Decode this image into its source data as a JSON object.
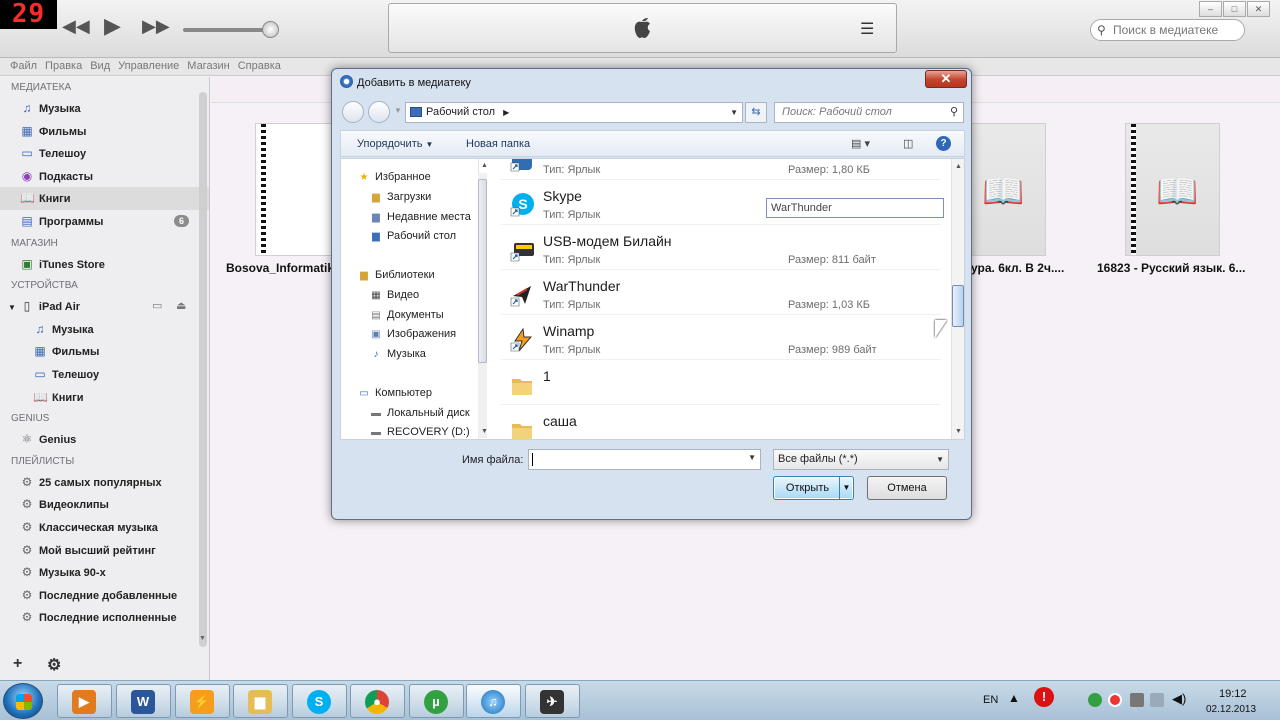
{
  "overlay_badge": "29",
  "itunes": {
    "search_placeholder": "Поиск в медиатеке",
    "menu": [
      "Файл",
      "Правка",
      "Вид",
      "Управление",
      "Магазин",
      "Справка"
    ]
  },
  "sidebar": {
    "sections": {
      "library": "МЕДИАТЕКА",
      "store": "МАГАЗИН",
      "devices": "УСТРОЙСТВА",
      "genius": "GENIUS",
      "playlists": "ПЛЕЙЛИСТЫ"
    },
    "library_items": [
      {
        "label": "Музыка",
        "icon": "♫"
      },
      {
        "label": "Фильмы",
        "icon": "▦"
      },
      {
        "label": "Телешоу",
        "icon": "▭"
      },
      {
        "label": "Подкасты",
        "icon": "◉"
      },
      {
        "label": "Книги",
        "icon": "📖"
      },
      {
        "label": "Программы",
        "icon": "▤",
        "count": "6"
      }
    ],
    "store_items": [
      {
        "label": "iTunes Store",
        "icon": "▣"
      }
    ],
    "device": {
      "label": "iPad Air"
    },
    "device_items": [
      {
        "label": "Музыка",
        "icon": "♫"
      },
      {
        "label": "Фильмы",
        "icon": "▦"
      },
      {
        "label": "Телешоу",
        "icon": "▭"
      },
      {
        "label": "Книги",
        "icon": "📖"
      }
    ],
    "genius_items": [
      {
        "label": "Genius",
        "icon": "⚛"
      }
    ],
    "playlists": [
      "25 самых популярных",
      "Видеоклипы",
      "Классическая музыка",
      "Мой высший рейтинг",
      "Музыка 90-х",
      "Последние добавленные",
      "Последние исполненные"
    ]
  },
  "books": [
    {
      "title": "Bosova_Informatik..."
    },
    {
      "title": "ура. 6кл. В 2ч...."
    },
    {
      "title": "16823 - Русский язык. 6..."
    }
  ],
  "dialog": {
    "title": "Добавить в медиатеку",
    "address": "Рабочий стол",
    "search_placeholder": "Поиск: Рабочий стол",
    "toolbar": {
      "organize": "Упорядочить",
      "new_folder": "Новая папка"
    },
    "nav": {
      "favorites": "Избранное",
      "favorites_items": [
        "Загрузки",
        "Недавние места",
        "Рабочий стол"
      ],
      "libraries": "Библиотеки",
      "libraries_items": [
        "Видео",
        "Документы",
        "Изображения",
        "Музыка"
      ],
      "computer": "Компьютер",
      "computer_items": [
        "Локальный диск",
        "RECOVERY (D:)"
      ]
    },
    "files": [
      {
        "name": "",
        "type": "Тип: Ярлык",
        "size": "Размер: 1,80 КБ"
      },
      {
        "name": "Skype",
        "type": "Тип: Ярлык",
        "size": ""
      },
      {
        "name": "USB-модем Билайн",
        "type": "Тип: Ярлык",
        "size": "Размер: 811 байт"
      },
      {
        "name": "WarThunder",
        "type": "Тип: Ярлык",
        "size": "Размер: 1,03 КБ"
      },
      {
        "name": "Winamp",
        "type": "Тип: Ярлык",
        "size": "Размер: 989 байт"
      },
      {
        "name": "1",
        "type": "",
        "size": ""
      },
      {
        "name": "саша",
        "type": "",
        "size": ""
      }
    ],
    "rename_value": "WarThunder",
    "filename_label": "Имя файла:",
    "filename_value": "",
    "filter": "Все файлы (*.*)",
    "open": "Открыть",
    "cancel": "Отмена"
  },
  "taskbar": {
    "lang": "EN",
    "time": "19:12",
    "date": "02.12.2013"
  },
  "colors": {
    "sidebar_icon": "#3b66b3",
    "dialog_frame": "#d6e2f0",
    "badge_red": "#ff2a2a"
  }
}
